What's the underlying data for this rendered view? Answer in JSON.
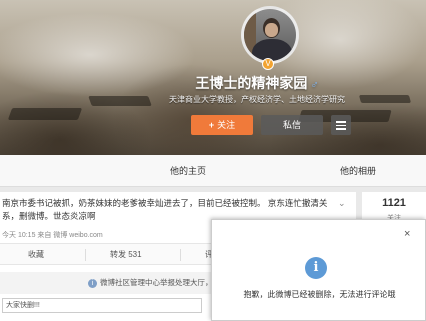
{
  "profile": {
    "name": "王博士的精神家园",
    "bio": "天津商业大学教授，产权经济学、土地经济学研究",
    "follow_label": "关注",
    "follow_plus": "+",
    "message_label": "私信",
    "gender_icon": "male-icon",
    "verified_badge": "V"
  },
  "tabs": [
    {
      "label": "他的主页"
    },
    {
      "label": "他的相册"
    }
  ],
  "post": {
    "text_line1": "南京市委书记被抓，奶茶妹妹的老爹被幸灿进去了，目前已经被控制。 京东连忙撤清关",
    "text_line2": "系，删微博。世态炎凉啊",
    "meta": "今天 10:15 来自 微博 weibo.com",
    "actions": {
      "favorite": "收藏",
      "repost": "转发 531",
      "comment": "评"
    },
    "notice": "微博社区管理中心举报处理大厅，",
    "comment_placeholder": "大家快删!!!"
  },
  "stats": {
    "count": "1121",
    "label": "关注"
  },
  "dialog": {
    "message": "抱歉，此微博已经被删除，无法进行评论哦",
    "close_label": "×",
    "info_glyph": "i"
  },
  "colors": {
    "follow_button": "#f07a3a",
    "link": "#eb7350",
    "info_icon": "#5d9ad6"
  }
}
